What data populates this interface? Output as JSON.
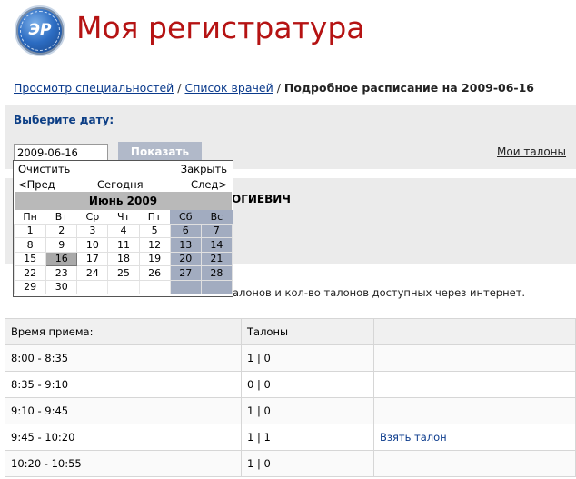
{
  "header": {
    "logo_text": "ЭР",
    "title": "Моя регистратура"
  },
  "breadcrumb": {
    "link1": "Просмотр специальностей",
    "separator": "/",
    "link2": "Список врачей",
    "current": "Подробное расписание на 2009-06-16"
  },
  "date_panel": {
    "label": "Выберите дату:",
    "date_value": "2009-06-16",
    "show_button": "Показать",
    "my_tickets": "Мои талоны"
  },
  "doctor": {
    "name_fragment": "ОГИЕВИЧ"
  },
  "info": {
    "text": "алонов и кол-во талонов доступных через интернет."
  },
  "calendar": {
    "clear": "Очистить",
    "close": "Закрыть",
    "prev": "<Пред",
    "today": "Сегодня",
    "next": "След>",
    "month": "Июнь 2009",
    "weekdays": [
      "Пн",
      "Вт",
      "Ср",
      "Чт",
      "Пт",
      "Сб",
      "Вс"
    ],
    "weeks": [
      [
        "1",
        "2",
        "3",
        "4",
        "5",
        "6",
        "7"
      ],
      [
        "8",
        "9",
        "10",
        "11",
        "12",
        "13",
        "14"
      ],
      [
        "15",
        "16",
        "17",
        "18",
        "19",
        "20",
        "21"
      ],
      [
        "22",
        "23",
        "24",
        "25",
        "26",
        "27",
        "28"
      ],
      [
        "29",
        "30",
        "",
        "",
        "",
        "",
        ""
      ]
    ],
    "selected_day": "16"
  },
  "schedule": {
    "headers": [
      "Время приема:",
      "Талоны",
      ""
    ],
    "rows": [
      {
        "time": "8:00 - 8:35",
        "tickets": "1 | 0",
        "action": ""
      },
      {
        "time": "8:35 - 9:10",
        "tickets": "0 | 0",
        "action": ""
      },
      {
        "time": "9:10 - 9:45",
        "tickets": "1 | 0",
        "action": ""
      },
      {
        "time": "9:45 - 10:20",
        "tickets": "1 | 1",
        "action": "Взять талон"
      },
      {
        "time": "10:20 - 10:55",
        "tickets": "1 | 0",
        "action": ""
      }
    ]
  }
}
